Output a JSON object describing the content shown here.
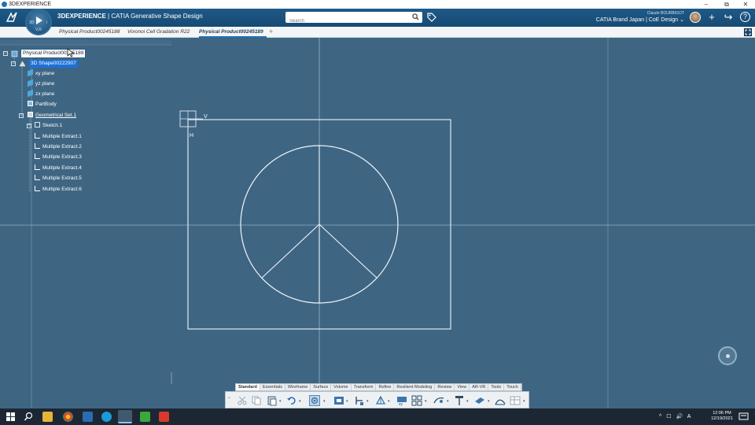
{
  "window": {
    "title": "3DEXPERIENCE",
    "minimize": "–",
    "restore": "⧉",
    "close": "✕"
  },
  "header": {
    "brand_bold": "3DEXPERIENCE",
    "brand_rest": " | CATIA Generative Shape Design",
    "compass_label": "V,R",
    "compass_left": "3D",
    "compass_right": "i",
    "search_placeholder": "Search",
    "user_name": "Claude BOURBIGOT",
    "user_context": "CATIA Brand Japan | CoE Design ⌄",
    "add_button": "+",
    "share_button": "↪",
    "help_button": "?"
  },
  "tabs": [
    {
      "label": "Physical Product00245188",
      "active": false
    },
    {
      "label": "Voronoi Cell Gradation R22",
      "active": false
    },
    {
      "label": "Physical Product00245189",
      "active": true
    }
  ],
  "tab_add": "+",
  "tree": {
    "root": "Physical Product00245189",
    "shape": "3D Shape00222907",
    "items": [
      {
        "label": "xy plane"
      },
      {
        "label": "yz plane"
      },
      {
        "label": "zx plane"
      },
      {
        "label": "PartBody"
      },
      {
        "label": "Geometrical Set.1"
      },
      {
        "label": "Sketch.1"
      },
      {
        "label": "Multiple Extract.1"
      },
      {
        "label": "Multiple Extract.2"
      },
      {
        "label": "Multiple Extract.3"
      },
      {
        "label": "Multiple Extract.4"
      },
      {
        "label": "Multiple Extract.5"
      },
      {
        "label": "Multiple Extract.6"
      }
    ]
  },
  "sketch": {
    "axis_v": "V",
    "axis_h": "H"
  },
  "action_bar": {
    "tabs": [
      "Standard",
      "Essentials",
      "Wireframe",
      "Surface",
      "Volume",
      "Transform",
      "Refine",
      "Resilient Modeling",
      "Review",
      "View",
      "AR-VR",
      "Tools",
      "Touch"
    ],
    "active_tab": "Standard"
  },
  "taskbar": {
    "time": "12:06 PM",
    "date": "12/19/2021",
    "tray": "^ ☐ 🔊 A"
  },
  "colors": {
    "canvas_bg": "#3e6683",
    "header_bg": "#1e5a88",
    "selection_blue": "#1e70d8"
  }
}
